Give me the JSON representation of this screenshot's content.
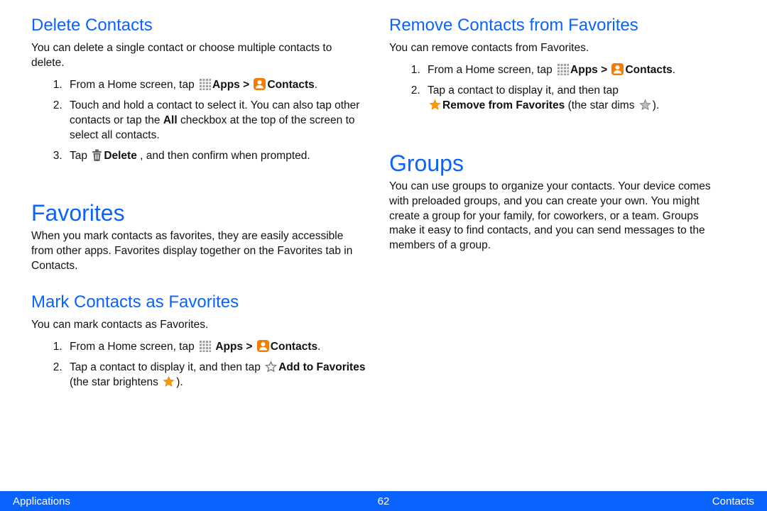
{
  "left": {
    "delete": {
      "heading": "Delete Contacts",
      "intro": "You can delete a single contact or choose multiple contacts to delete.",
      "step1_pre": "From a Home screen, tap ",
      "apps_label": "Apps > ",
      "contacts_label": "Contacts",
      "step1_post": ".",
      "step2_a": "Touch and hold a contact to select it. You can also tap other contacts or tap the ",
      "step2_b": "All",
      "step2_c": " checkbox at the top of the screen to select all contacts.",
      "step3_a": "Tap ",
      "step3_b": "Delete",
      "step3_c": " , and then confirm when prompted."
    },
    "favorites": {
      "heading": "Favorites",
      "intro": "When you mark contacts as favorites, they are easily accessible from other apps. Favorites display together on the Favorites tab in Contacts.",
      "mark": {
        "heading": "Mark Contacts as Favorites",
        "intro": "You can mark contacts as Favorites.",
        "step1_pre": "From a Home screen, tap ",
        "step2_a": "Tap a contact to display it, and then tap ",
        "step2_b": "Add to Favorites",
        "step2_c": " (the star brightens ",
        "step2_d": ")."
      }
    }
  },
  "right": {
    "remove": {
      "heading": "Remove Contacts from Favorites",
      "intro": "You can remove contacts from Favorites.",
      "step1_pre": "From a Home screen, tap ",
      "step2_a": "Tap a contact to display it, and then tap ",
      "step2_b": "Remove from Favorites",
      "step2_c": " (the star dims ",
      "step2_d": ")."
    },
    "groups": {
      "heading": "Groups",
      "intro": "You can use groups to organize your contacts. Your device comes with preloaded groups, and you can create your own. You might create a group for your family, for coworkers, or a team. Groups make it easy to find contacts, and you can send messages to the members of a group."
    }
  },
  "common": {
    "apps_label": "Apps > ",
    "contacts_label": "Contacts"
  },
  "footer": {
    "left": "Applications",
    "center": "62",
    "right": "Contacts"
  }
}
